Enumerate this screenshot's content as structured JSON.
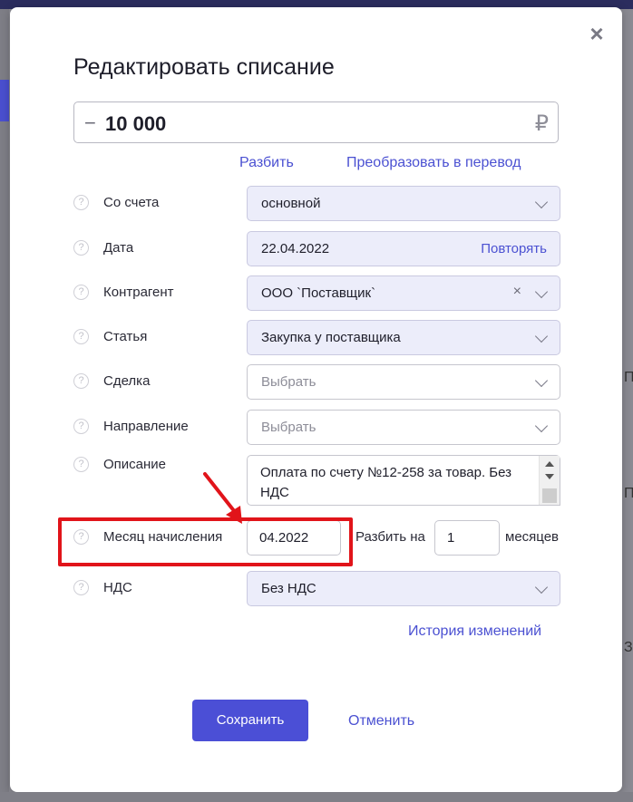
{
  "dialog": {
    "title": "Редактировать списание",
    "close_label": "×"
  },
  "amount": {
    "sign": "−",
    "value": "10 000",
    "currency": "₽"
  },
  "links": {
    "split": "Разбить",
    "convert": "Преобразовать в перевод",
    "history": "История изменений"
  },
  "help_icon": "?",
  "fields": {
    "account": {
      "label": "Со счета",
      "value": "основной"
    },
    "date": {
      "label": "Дата",
      "value": "22.04.2022",
      "action": "Повторять"
    },
    "counterparty": {
      "label": "Контрагент",
      "value": "ООО `Поставщик`",
      "clear": "×"
    },
    "article": {
      "label": "Статья",
      "value": "Закупка у поставщика"
    },
    "deal": {
      "label": "Сделка",
      "placeholder": "Выбрать"
    },
    "direction": {
      "label": "Направление",
      "placeholder": "Выбрать"
    },
    "description": {
      "label": "Описание",
      "value": "Оплата по счету №12-258 за товар. Без НДС"
    },
    "accrual_month": {
      "label": "Месяц начисления",
      "value": "04.2022",
      "split_label": "Разбить на",
      "split_count": "1",
      "months_label": "месяцев"
    },
    "vat": {
      "label": "НДС",
      "value": "Без НДС"
    }
  },
  "buttons": {
    "save": "Сохранить",
    "cancel": "Отменить"
  },
  "background": {
    "right_fragments": [
      "Пр",
      "П",
      "Зо"
    ]
  },
  "colors": {
    "accent": "#4b4fd6",
    "highlight_red": "#e1141a",
    "field_bg": "#ecedfa"
  }
}
